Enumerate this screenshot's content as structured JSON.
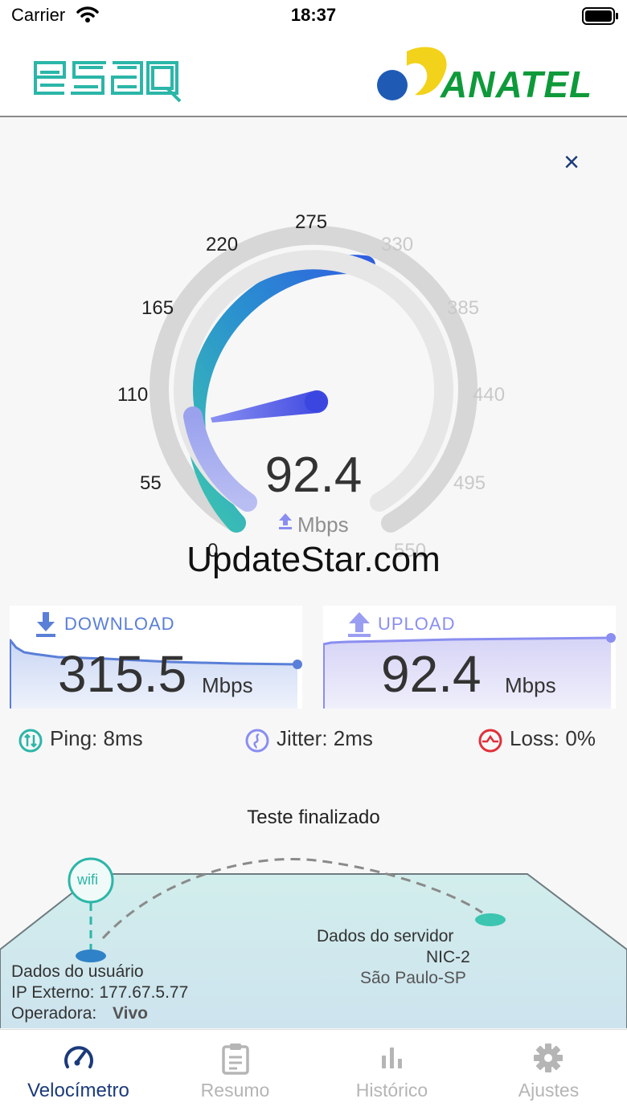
{
  "status_bar": {
    "carrier": "Carrier",
    "time": "18:37"
  },
  "header": {
    "logo_left": "esaq",
    "logo_right": "ANATEL"
  },
  "close_label": "×",
  "gauge": {
    "ticks_active": [
      "55",
      "110",
      "165",
      "220",
      "275"
    ],
    "ticks_inactive": [
      "330",
      "385",
      "440",
      "495",
      "550"
    ],
    "tick_zero": "0",
    "value": "92.4",
    "unit": "Mbps",
    "max": 550,
    "colors": {
      "arc_start": "#3cc5b0",
      "arc_end": "#2f5fe0",
      "needle": "#4b55e6",
      "track": "#d7d7d7"
    }
  },
  "watermark": "UpdateStar.com",
  "download": {
    "label": "DOWNLOAD",
    "value": "315.5",
    "unit": "Mbps"
  },
  "upload": {
    "label": "UPLOAD",
    "value": "92.4",
    "unit": "Mbps"
  },
  "metrics": {
    "ping": "Ping: 8ms",
    "jitter": "Jitter: 2ms",
    "loss": "Loss: 0%"
  },
  "status_text": "Teste finalizado",
  "map": {
    "wifi_label": "wifi",
    "user_title": "Dados do usuário",
    "user_ip": "IP Externo: 177.67.5.77",
    "user_operator_label": "Operadora:",
    "user_operator": "Vivo",
    "server_title": "Dados do servidor",
    "server_name": "NIC-2",
    "server_location": "São Paulo-SP"
  },
  "tabs": [
    {
      "label": "Velocímetro",
      "icon": "speedometer-icon",
      "active": true
    },
    {
      "label": "Resumo",
      "icon": "clipboard-icon",
      "active": false
    },
    {
      "label": "Histórico",
      "icon": "bar-chart-icon",
      "active": false
    },
    {
      "label": "Ajustes",
      "icon": "gear-icon",
      "active": false
    }
  ]
}
